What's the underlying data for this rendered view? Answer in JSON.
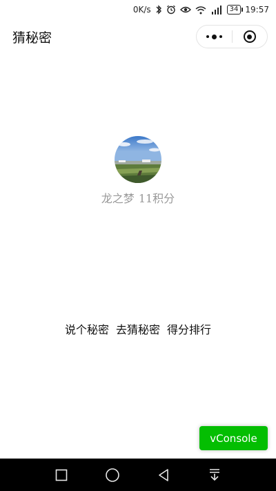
{
  "statusbar": {
    "speed": "0K/s",
    "icons": [
      "bluetooth-icon",
      "alarm-icon",
      "eye-icon",
      "wifi-icon",
      "signal-icon"
    ],
    "battery": "34",
    "time": "19:57"
  },
  "navbar": {
    "title": "猜秘密",
    "capsule": {
      "menu_icon": "more-dots-icon",
      "close_icon": "target-icon"
    }
  },
  "profile": {
    "name": "龙之梦",
    "score": "11积分",
    "avatar_icon": "landscape-avatar"
  },
  "actions": [
    {
      "label": "说个秘密"
    },
    {
      "label": "去猜秘密"
    },
    {
      "label": "得分排行"
    }
  ],
  "vconsole": {
    "label": "vConsole",
    "color": "#04be02"
  },
  "androidbar": {
    "buttons": [
      "recent-apps-icon",
      "home-icon",
      "back-icon",
      "notification-pull-icon"
    ]
  }
}
